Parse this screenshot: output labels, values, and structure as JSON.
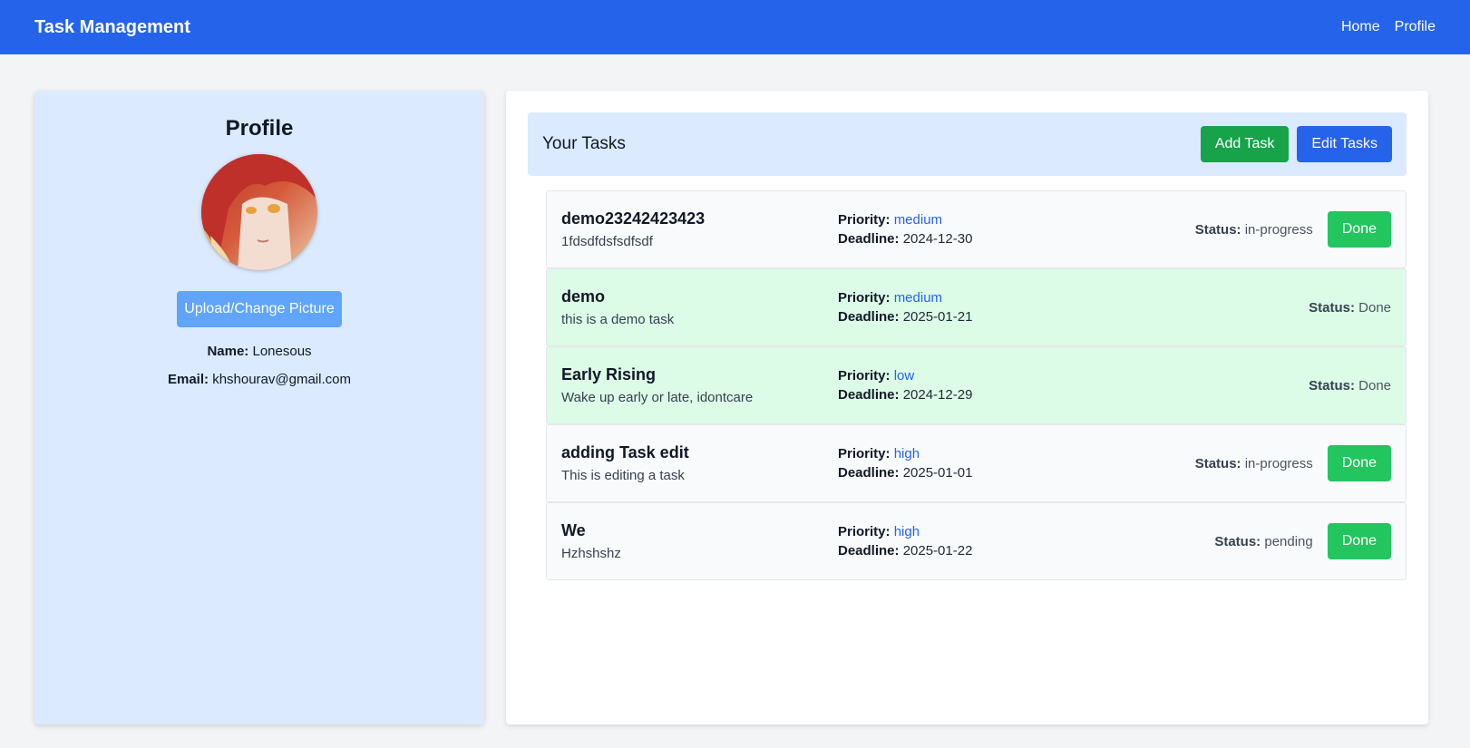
{
  "navbar": {
    "brand": "Task Management",
    "links": [
      "Home",
      "Profile"
    ]
  },
  "profile": {
    "title": "Profile",
    "upload_label": "Upload/Change Picture",
    "name_label": "Name:",
    "name": "Lonesous",
    "email_label": "Email:",
    "email": "khshourav@gmail.com"
  },
  "tasks": {
    "title": "Your Tasks",
    "add_label": "Add Task",
    "edit_label": "Edit Tasks",
    "priority_label": "Priority:",
    "deadline_label": "Deadline:",
    "status_label": "Status:",
    "done_label": "Done",
    "items": [
      {
        "name": "demo23242423423",
        "desc": "1fdsdfdsfsdfsdf",
        "priority": "medium",
        "deadline": "2024-12-30",
        "status": "in-progress"
      },
      {
        "name": "demo",
        "desc": "this is a demo task",
        "priority": "medium",
        "deadline": "2025-01-21",
        "status": "Done"
      },
      {
        "name": "Early Rising",
        "desc": "Wake up early or late, idontcare",
        "priority": "low",
        "deadline": "2024-12-29",
        "status": "Done"
      },
      {
        "name": "adding Task edit",
        "desc": "This is editing a task",
        "priority": "high",
        "deadline": "2025-01-01",
        "status": "in-progress"
      },
      {
        "name": "We",
        "desc": "Hzhshshz",
        "priority": "high",
        "deadline": "2025-01-22",
        "status": "pending"
      }
    ]
  },
  "colors": {
    "nav_bg": "#2563eb",
    "done_row_bg": "#dcfce7",
    "done_btn": "#22c55e",
    "add_btn": "#16a34a",
    "priority_text": "#2563eb"
  }
}
